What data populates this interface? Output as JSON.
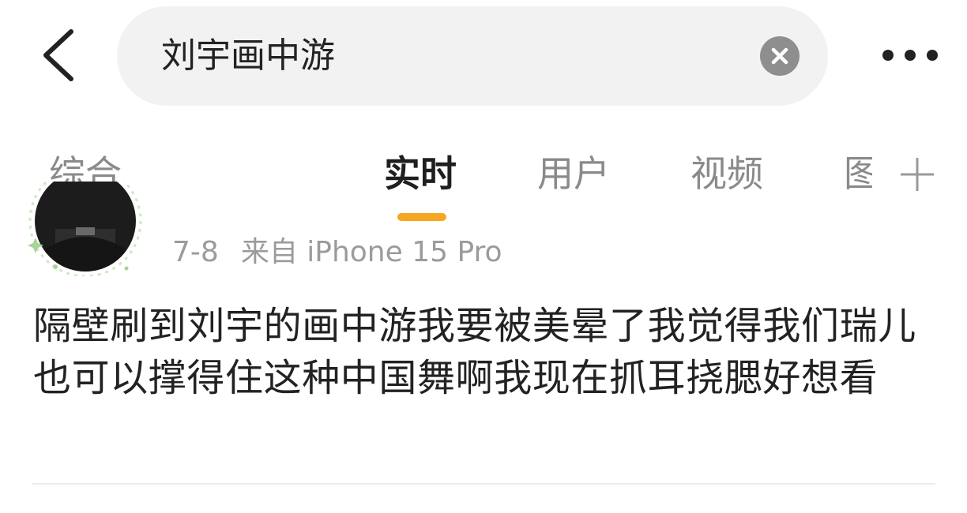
{
  "search": {
    "query": "刘宇画中游"
  },
  "tabs": [
    {
      "label": "综合",
      "active": false
    },
    {
      "label": "实时",
      "active": true
    },
    {
      "label": "用户",
      "active": false
    },
    {
      "label": "视频",
      "active": false
    },
    {
      "label": "图",
      "active": false
    }
  ],
  "post": {
    "date": "7-8",
    "source": "来自 iPhone 15 Pro",
    "text": "隔壁刷到刘宇的画中游我要被美晕了我觉得我们瑞儿也可以撑得住这种中国舞啊我现在抓耳挠腮好想看"
  },
  "colors": {
    "accent": "#f5a623",
    "search_bg": "#f2f2f2",
    "muted_text": "#8a8a8a"
  },
  "icons": {
    "back": "chevron-left-icon",
    "clear": "close-circle-icon",
    "more": "more-dots-icon",
    "add_tab": "plus-icon"
  }
}
